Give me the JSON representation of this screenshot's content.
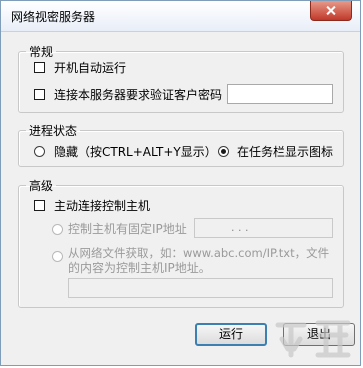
{
  "window": {
    "title": "网络视密服务器"
  },
  "general": {
    "legend": "常规",
    "autostart_label": "开机自动运行",
    "verify_label": "连接本服务器要求验证客户密码",
    "password_value": ""
  },
  "process_state": {
    "legend": "进程状态",
    "hide_label": "隐藏（按CTRL+ALT+Y显示）",
    "tray_label": "在任务栏显示图标",
    "selected": "tray"
  },
  "advanced": {
    "legend": "高级",
    "active_connect_label": "主动连接控制主机",
    "fixed_ip_label": "控制主机有固定IP地址",
    "ip_placeholder": ". . .",
    "fetch_label_line1": "从网络文件获取，如：www.abc.com/IP.txt，文件",
    "fetch_label_line2": "的内容为控制主机IP地址。",
    "fetch_url_value": ""
  },
  "buttons": {
    "run": "运行",
    "exit": "退出"
  },
  "colors": {
    "close_button": "#c0392b",
    "default_button_border": "#3c7fb1",
    "watermark": "#c8c8c8"
  }
}
